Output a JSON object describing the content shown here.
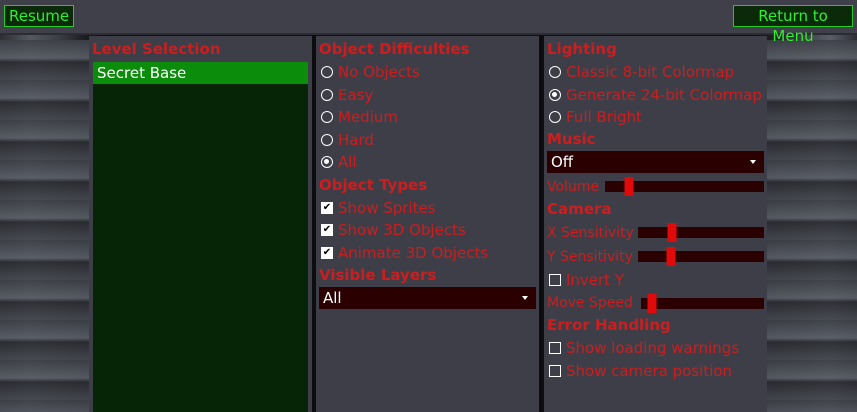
{
  "topbar": {
    "resume_label": "Resume",
    "return_label": "Return to Menu"
  },
  "level_selection": {
    "title": "Level Selection",
    "items": [
      {
        "label": "Secret Base",
        "selected": true
      }
    ]
  },
  "object_difficulties": {
    "title": "Object Difficulties",
    "options": [
      {
        "label": "No Objects",
        "selected": false
      },
      {
        "label": "Easy",
        "selected": false
      },
      {
        "label": "Medium",
        "selected": false
      },
      {
        "label": "Hard",
        "selected": false
      },
      {
        "label": "All",
        "selected": true
      }
    ]
  },
  "object_types": {
    "title": "Object Types",
    "options": [
      {
        "label": "Show Sprites",
        "checked": true
      },
      {
        "label": "Show 3D Objects",
        "checked": true
      },
      {
        "label": "Animate 3D Objects",
        "checked": true
      }
    ]
  },
  "visible_layers": {
    "title": "Visible Layers",
    "value": "All"
  },
  "lighting": {
    "title": "Lighting",
    "options": [
      {
        "label": "Classic 8-bit Colormap",
        "selected": false
      },
      {
        "label": "Generate 24-bit Colormap",
        "selected": true
      },
      {
        "label": "Full Bright",
        "selected": false
      }
    ]
  },
  "music": {
    "title": "Music",
    "value": "Off",
    "volume_label": "Volume",
    "volume": 0.15
  },
  "camera": {
    "title": "Camera",
    "x_sensitivity_label": "X Sensitivity",
    "x_sensitivity": 0.27,
    "y_sensitivity_label": "Y Sensitivity",
    "y_sensitivity": 0.26,
    "invert_y_label": "Invert Y",
    "invert_y": false,
    "move_speed_label": "Move Speed",
    "move_speed": 0.09
  },
  "error_handling": {
    "title": "Error Handling",
    "show_loading_warnings_label": "Show loading warnings",
    "show_loading_warnings": false,
    "show_camera_position_label": "Show camera position",
    "show_camera_position": false
  },
  "colors": {
    "accent_red": "#cc1e1e",
    "button_green": "#2cf02c",
    "panel": "#3d3e47",
    "selection_green": "#0b8c0b"
  }
}
